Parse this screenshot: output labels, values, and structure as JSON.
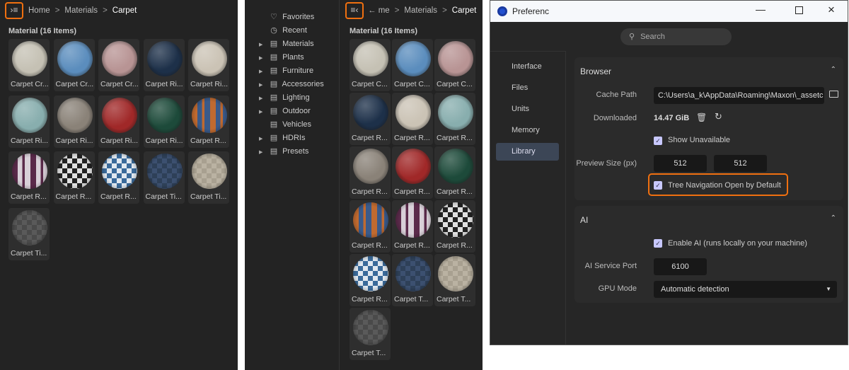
{
  "breadcrumb": {
    "home": "Home",
    "home_truncated": "me",
    "materials": "Materials",
    "current": "Carpet",
    "sep": ">"
  },
  "section_title": "Material (16 Items)",
  "materials": [
    {
      "label_wide": "Carpet Cr...",
      "label_narrow": "Carpet C...",
      "color": "#c5c1b4",
      "pattern": "plain"
    },
    {
      "label_wide": "Carpet Cr...",
      "label_narrow": "Carpet C...",
      "color": "#5b8dbd",
      "pattern": "plain"
    },
    {
      "label_wide": "Carpet Cr...",
      "label_narrow": "Carpet C...",
      "color": "#b89494",
      "pattern": "plain"
    },
    {
      "label_wide": "Carpet Ri...",
      "label_narrow": "Carpet R...",
      "color": "#1d3049",
      "pattern": "plain"
    },
    {
      "label_wide": "Carpet Ri...",
      "label_narrow": "Carpet R...",
      "color": "#cbc3b5",
      "pattern": "plain"
    },
    {
      "label_wide": "Carpet Ri...",
      "label_narrow": "Carpet R...",
      "color": "#88aeae",
      "pattern": "plain"
    },
    {
      "label_wide": "Carpet Ri...",
      "label_narrow": "Carpet R...",
      "color": "#8a8278",
      "pattern": "plain"
    },
    {
      "label_wide": "Carpet Ri...",
      "label_narrow": "Carpet R...",
      "color": "#a02828",
      "pattern": "plain"
    },
    {
      "label_wide": "Carpet Ri...",
      "label_narrow": "Carpet R...",
      "color": "#1d4a3a",
      "pattern": "plain"
    },
    {
      "label_wide": "Carpet R...",
      "label_narrow": "Carpet R...",
      "color": "#c06a30",
      "color2": "#3a5a8a",
      "pattern": "patch"
    },
    {
      "label_wide": "Carpet R...",
      "label_narrow": "Carpet R...",
      "color": "#5a2a4a",
      "color2": "#d8d0d8",
      "pattern": "patch"
    },
    {
      "label_wide": "Carpet R...",
      "label_narrow": "Carpet R...",
      "color": "#e0e0e0",
      "color2": "#222222",
      "pattern": "check"
    },
    {
      "label_wide": "Carpet R...",
      "label_narrow": "Carpet R...",
      "color": "#3a6a9a",
      "color2": "#e0e8f0",
      "pattern": "check"
    },
    {
      "label_wide": "Carpet Ti...",
      "label_narrow": "Carpet T...",
      "color": "#2e4058",
      "color2": "#3c5070",
      "pattern": "check"
    },
    {
      "label_wide": "Carpet Ti...",
      "label_narrow": "Carpet T...",
      "color": "#a8a090",
      "color2": "#bab2a2",
      "pattern": "check"
    },
    {
      "label_wide": "Carpet Ti...",
      "label_narrow": "Carpet T...",
      "color": "#4a4a4a",
      "color2": "#5a5a5a",
      "pattern": "check"
    }
  ],
  "tree": [
    {
      "label": "Favorites",
      "icon": "heart-icon",
      "expandable": false
    },
    {
      "label": "Recent",
      "icon": "clock-icon",
      "expandable": false
    },
    {
      "label": "Materials",
      "icon": "database-icon",
      "expandable": true
    },
    {
      "label": "Plants",
      "icon": "database-icon",
      "expandable": true
    },
    {
      "label": "Furniture",
      "icon": "database-icon",
      "expandable": true
    },
    {
      "label": "Accessories",
      "icon": "database-icon",
      "expandable": true
    },
    {
      "label": "Lighting",
      "icon": "database-icon",
      "expandable": true
    },
    {
      "label": "Outdoor",
      "icon": "database-icon",
      "expandable": true
    },
    {
      "label": "Vehicles",
      "icon": "database-icon",
      "expandable": false
    },
    {
      "label": "HDRIs",
      "icon": "database-icon",
      "expandable": true
    },
    {
      "label": "Presets",
      "icon": "database-icon",
      "expandable": true
    }
  ],
  "prefs": {
    "title": "Preferenc",
    "search_placeholder": "Search",
    "sidebar": [
      "Interface",
      "Files",
      "Units",
      "Memory",
      "Library"
    ],
    "active": "Library",
    "browser": {
      "title": "Browser",
      "cache_path_label": "Cache Path",
      "cache_path": "C:\\Users\\a_k\\AppData\\Roaming\\Maxon\\_assetc",
      "downloaded_label": "Downloaded",
      "downloaded": "14.47 GiB",
      "show_unavailable": "Show Unavailable",
      "preview_label": "Preview Size (px)",
      "preview_w": "512",
      "preview_h": "512",
      "tree_nav": "Tree Navigation Open by Default"
    },
    "ai": {
      "title": "AI",
      "enable": "Enable AI (runs locally on your machine)",
      "port_label": "AI Service Port",
      "port": "6100",
      "gpu_label": "GPU Mode",
      "gpu": "Automatic detection"
    }
  },
  "colors": {
    "highlight": "#f07010",
    "accent_check": "#c8c8ff",
    "active_nav": "#3c4656"
  }
}
